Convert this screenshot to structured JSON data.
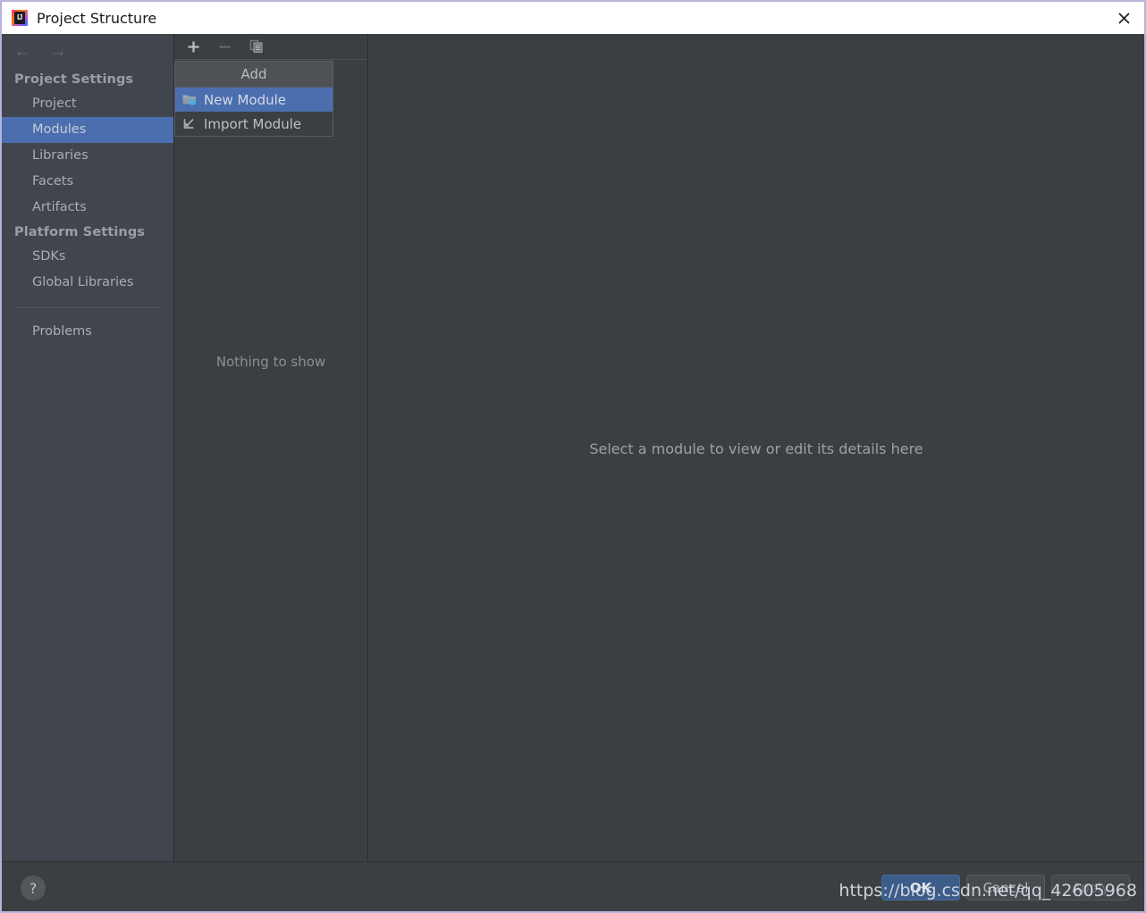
{
  "window": {
    "title": "Project Structure",
    "app_icon": "intellij-idea-icon",
    "icon_text": "IJ",
    "close_icon": "close-icon",
    "border_color": "#b6b2d9",
    "titlebar_bg": "#ffffff",
    "content_bg": "#3c3f41"
  },
  "sidebar": {
    "bg": "#41454d",
    "selection_color": "#4b6eaf",
    "nav": {
      "back_icon": "arrow-left-icon",
      "back_glyph": "←",
      "forward_icon": "arrow-right-icon",
      "forward_glyph": "→"
    },
    "groups": [
      {
        "label": "Project Settings",
        "items": [
          {
            "label": "Project",
            "selected": false
          },
          {
            "label": "Modules",
            "selected": true
          },
          {
            "label": "Libraries",
            "selected": false
          },
          {
            "label": "Facets",
            "selected": false
          },
          {
            "label": "Artifacts",
            "selected": false
          }
        ]
      },
      {
        "label": "Platform Settings",
        "items": [
          {
            "label": "SDKs",
            "selected": false
          },
          {
            "label": "Global Libraries",
            "selected": false
          }
        ]
      }
    ],
    "footer_items": [
      {
        "label": "Problems",
        "selected": false
      }
    ]
  },
  "modules_panel": {
    "toolbar": {
      "add_icon": "plus-icon",
      "remove_icon": "minus-icon",
      "copy_icon": "copy-icon"
    },
    "empty_text": "Nothing to show"
  },
  "add_popup": {
    "header": "Add",
    "items": [
      {
        "label": "New Module",
        "icon": "new-module-folder-icon",
        "highlighted": true
      },
      {
        "label": "Import Module",
        "icon": "import-module-arrow-icon",
        "highlighted": false
      }
    ]
  },
  "details": {
    "message": "Select a module to view or edit its details here"
  },
  "bottom_bar": {
    "help_icon": "question-mark-icon",
    "help_glyph": "?",
    "buttons": [
      {
        "label": "OK",
        "state": "primary"
      },
      {
        "label": "Cancel",
        "state": "normal"
      },
      {
        "label": "Apply",
        "state": "disabled"
      }
    ]
  },
  "watermark": {
    "text": "https://blog.csdn.net/qq_42605968"
  }
}
